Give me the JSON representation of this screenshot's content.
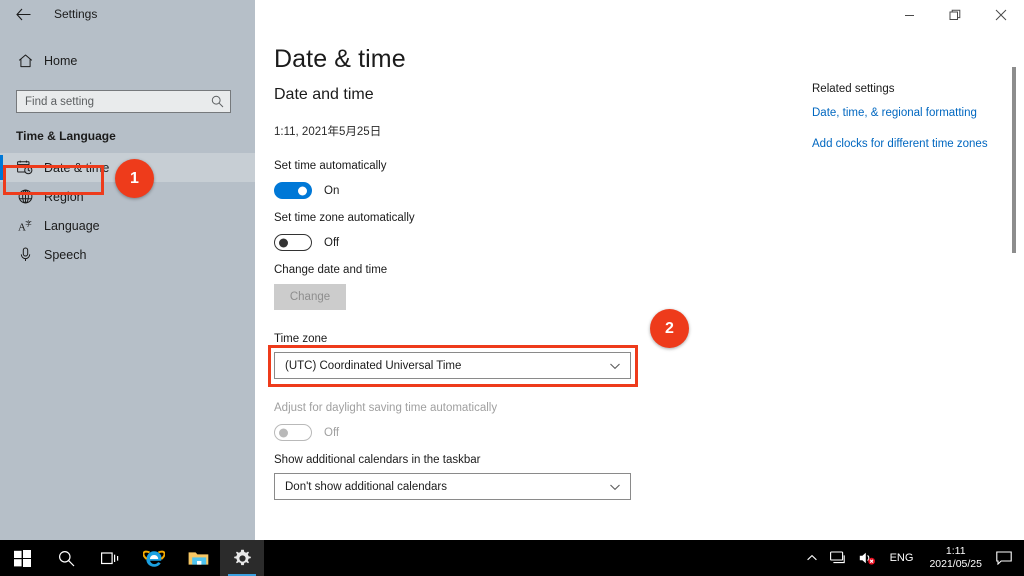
{
  "window": {
    "app_name": "Settings",
    "back_icon": "back-arrow-icon",
    "controls": {
      "minimize": "minimize-icon",
      "restore": "restore-icon",
      "close": "close-icon"
    }
  },
  "sidebar": {
    "home": {
      "label": "Home",
      "icon": "home-icon"
    },
    "search": {
      "placeholder": "Find a setting",
      "icon": "search-icon"
    },
    "category": "Time & Language",
    "items": [
      {
        "label": "Date & time",
        "icon": "calendar-clock-icon",
        "selected": true
      },
      {
        "label": "Region",
        "icon": "globe-icon",
        "selected": false
      },
      {
        "label": "Language",
        "icon": "language-icon",
        "selected": false
      },
      {
        "label": "Speech",
        "icon": "microphone-icon",
        "selected": false
      }
    ]
  },
  "main": {
    "page_title": "Date & time",
    "section_title": "Date and time",
    "current_datetime": "1:11, 2021年5月25日",
    "set_time_auto": {
      "label": "Set time automatically",
      "state": "On",
      "on": true
    },
    "set_timezone_auto": {
      "label": "Set time zone automatically",
      "state": "Off",
      "on": false
    },
    "change_datetime": {
      "label": "Change date and time",
      "button": "Change",
      "disabled": true
    },
    "time_zone": {
      "label": "Time zone",
      "value": "(UTC) Coordinated Universal Time",
      "chevron": "chevron-down-icon"
    },
    "dst": {
      "label": "Adjust for daylight saving time automatically",
      "state": "Off",
      "on": false,
      "disabled": true
    },
    "calendars": {
      "label": "Show additional calendars in the taskbar",
      "value": "Don't show additional calendars",
      "chevron": "chevron-down-icon"
    }
  },
  "related": {
    "title": "Related settings",
    "links": [
      "Date, time, & regional formatting",
      "Add clocks for different time zones"
    ]
  },
  "annotations": [
    {
      "number": "1"
    },
    {
      "number": "2"
    }
  ],
  "taskbar": {
    "icons": [
      {
        "name": "start-button",
        "icon": "windows-logo-icon"
      },
      {
        "name": "search-button",
        "icon": "search-icon"
      },
      {
        "name": "task-view-button",
        "icon": "task-view-icon"
      },
      {
        "name": "internet-explorer-button",
        "icon": "internet-explorer-icon"
      },
      {
        "name": "file-explorer-button",
        "icon": "folder-icon"
      },
      {
        "name": "settings-button",
        "icon": "gear-icon"
      }
    ],
    "tray": {
      "chevron": "chevron-up-icon",
      "network": "network-icon",
      "volume": "volume-muted-icon",
      "language": "ENG",
      "clock_time": "1:11",
      "clock_date": "2021/05/25",
      "action_center": "notification-icon"
    }
  },
  "colors": {
    "accent": "#0078d7",
    "annotation": "#ee3b1b",
    "link": "#0067c0",
    "sidebar_bg": "#b6bfc8"
  }
}
